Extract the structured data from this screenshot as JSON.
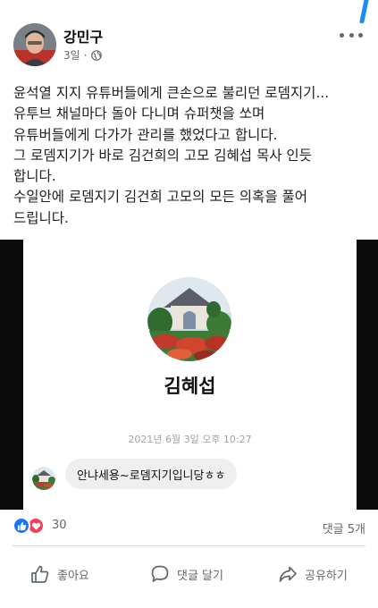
{
  "post": {
    "author": "강민구",
    "time": "3일",
    "privacy_icon": "globe-icon",
    "text_lines": [
      "윤석열 지지 유튜버들에게 큰손으로 불리던 로뎀지기...",
      "유투브 채널마다 돌아 다니며 슈퍼챗을 쏘며",
      "유튜버들에게 다가가 관리를 했었다고 합니다.",
      "그 로뎀지기가 바로 김건희의 고모 김혜섭 목사 인듯",
      "합니다.",
      "수일안에 로뎀지기 김건희 고모의 모든 의혹을 풀어",
      "드립니다."
    ]
  },
  "image": {
    "profile_name": "김혜섭",
    "timestamp": "2021년 6월 3일 오후 10:27",
    "message": "안냐세용~로뎀지기입니당ㅎㅎ"
  },
  "reactions": {
    "count": "30",
    "comments": "댓글 5개",
    "icons": [
      "like-reaction-icon",
      "love-reaction-icon"
    ]
  },
  "actions": {
    "like": "좋아요",
    "comment": "댓글 달기",
    "share": "공유하기"
  },
  "colors": {
    "like_blue": "#1877f2",
    "love_red": "#f33e58",
    "secondary_text": "#65676b",
    "accent_stroke": "#1a8cff"
  }
}
